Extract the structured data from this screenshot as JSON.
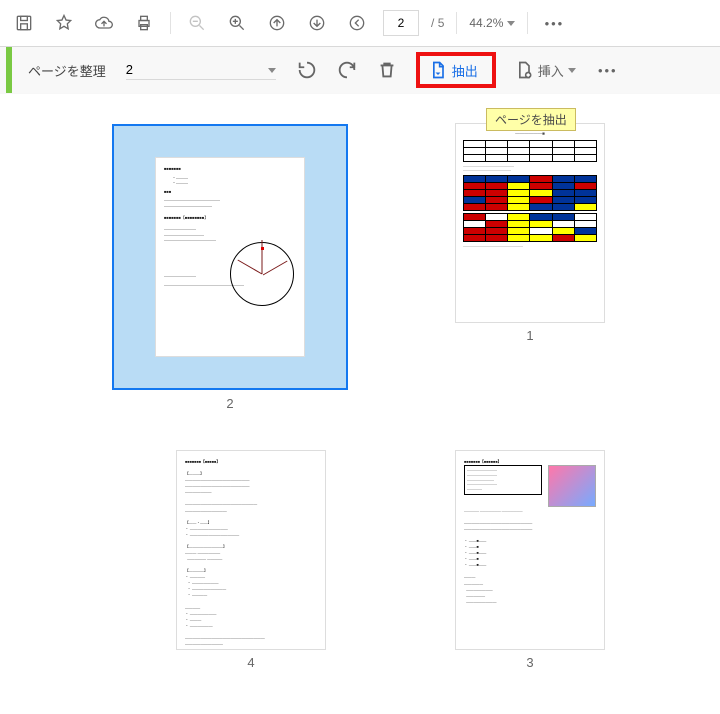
{
  "topbar": {
    "page_current": "2",
    "page_sep": "/",
    "page_total": "5",
    "zoom": "44.2%"
  },
  "secbar": {
    "title": "ページを整理",
    "page_field": "2",
    "extract_label": "抽出",
    "insert_label": "挿入",
    "tooltip": "ページを抽出"
  },
  "thumbs": {
    "labels": [
      "2",
      "1",
      "4",
      "3"
    ]
  }
}
